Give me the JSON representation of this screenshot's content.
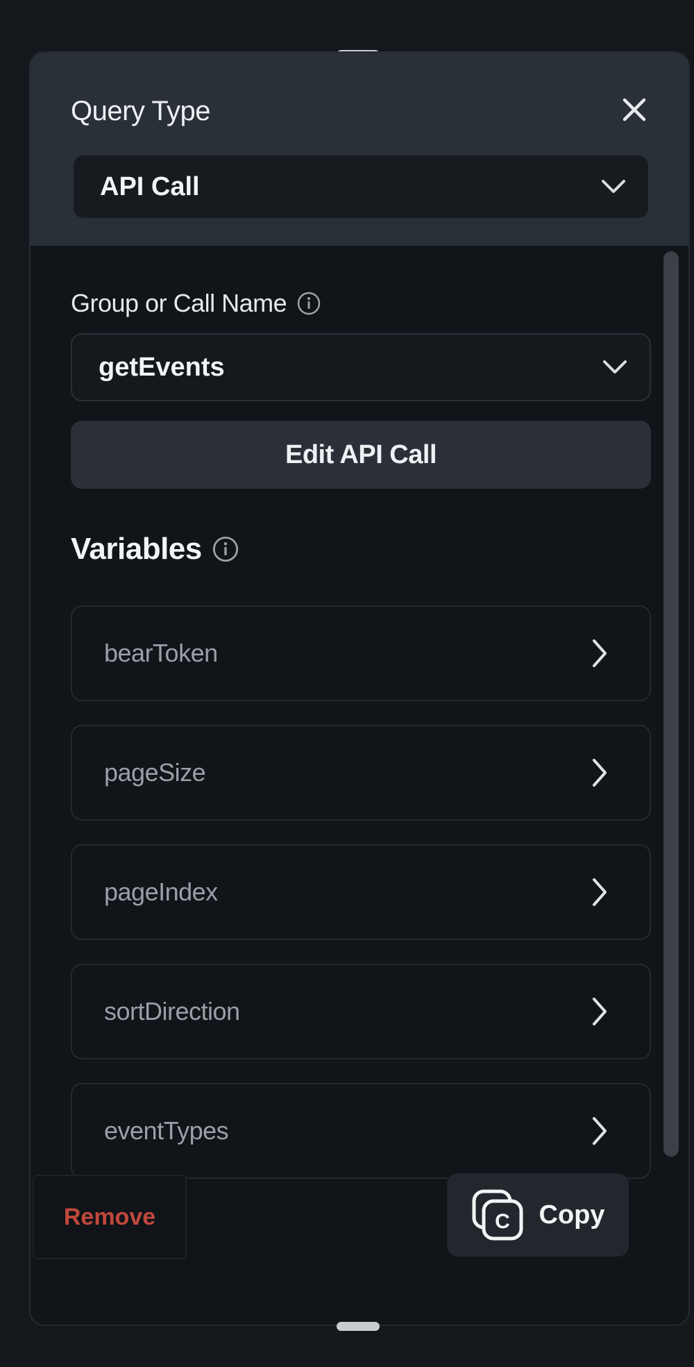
{
  "header": {
    "title": "Query Type",
    "query_type_value": "API Call"
  },
  "call_name": {
    "label": "Group or Call Name",
    "value": "getEvents"
  },
  "edit_button_label": "Edit API Call",
  "variables": {
    "title": "Variables",
    "items": [
      {
        "label": "bearToken"
      },
      {
        "label": "pageSize"
      },
      {
        "label": "pageIndex"
      },
      {
        "label": "sortDirection"
      },
      {
        "label": "eventTypes"
      }
    ]
  },
  "footer": {
    "remove_label": "Remove",
    "copy_label": "Copy",
    "copy_icon_letter": "C"
  },
  "colors": {
    "background": "#14171c",
    "panel": "#111418",
    "header": "#2a3038",
    "remove_text": "#c0493c",
    "muted_text": "#9aa0a8"
  },
  "icons": [
    "close-icon",
    "chevron-down-icon",
    "info-icon",
    "chevron-right-icon",
    "copy-icon"
  ]
}
